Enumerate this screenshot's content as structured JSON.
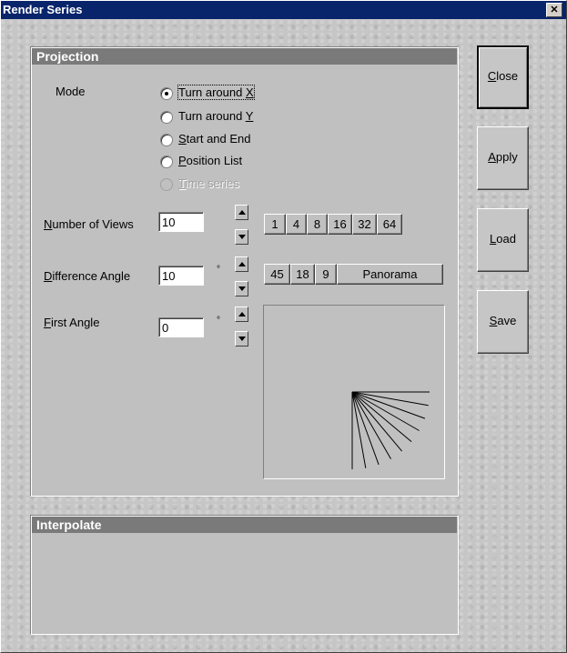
{
  "window": {
    "title": "Render Series",
    "close_glyph": "✕"
  },
  "projection": {
    "header": "Projection",
    "mode_label": "Mode",
    "modes": [
      {
        "pre": "Turn around ",
        "u": "X",
        "post": "",
        "checked": true,
        "enabled": true
      },
      {
        "pre": "Turn around ",
        "u": "Y",
        "post": "",
        "checked": false,
        "enabled": true
      },
      {
        "pre": "",
        "u": "S",
        "post": "tart and End",
        "checked": false,
        "enabled": true
      },
      {
        "pre": "",
        "u": "P",
        "post": "osition List",
        "checked": false,
        "enabled": true
      },
      {
        "pre": "",
        "u": "T",
        "post": "ime series",
        "checked": false,
        "enabled": false
      }
    ],
    "number_of_views": {
      "u": "N",
      "rest": "umber of Views",
      "value": "10",
      "presets": [
        "1",
        "4",
        "8",
        "16",
        "32",
        "64"
      ]
    },
    "difference_angle": {
      "u": "D",
      "rest": "ifference Angle",
      "value": "10",
      "unit": "°",
      "presets": [
        "45",
        "18",
        "9",
        "Panorama"
      ]
    },
    "first_angle": {
      "u": "F",
      "rest": "irst Angle",
      "value": "0",
      "unit": "°"
    }
  },
  "interpolate": {
    "header": "Interpolate"
  },
  "buttons": [
    {
      "u": "C",
      "rest": "lose"
    },
    {
      "u": "A",
      "rest": "pply"
    },
    {
      "u": "L",
      "rest": "oad"
    },
    {
      "u": "S",
      "rest": "ave"
    }
  ],
  "preview": {
    "angles_deg": [
      0,
      10,
      20,
      30,
      40,
      50,
      60,
      70,
      80,
      90
    ]
  }
}
